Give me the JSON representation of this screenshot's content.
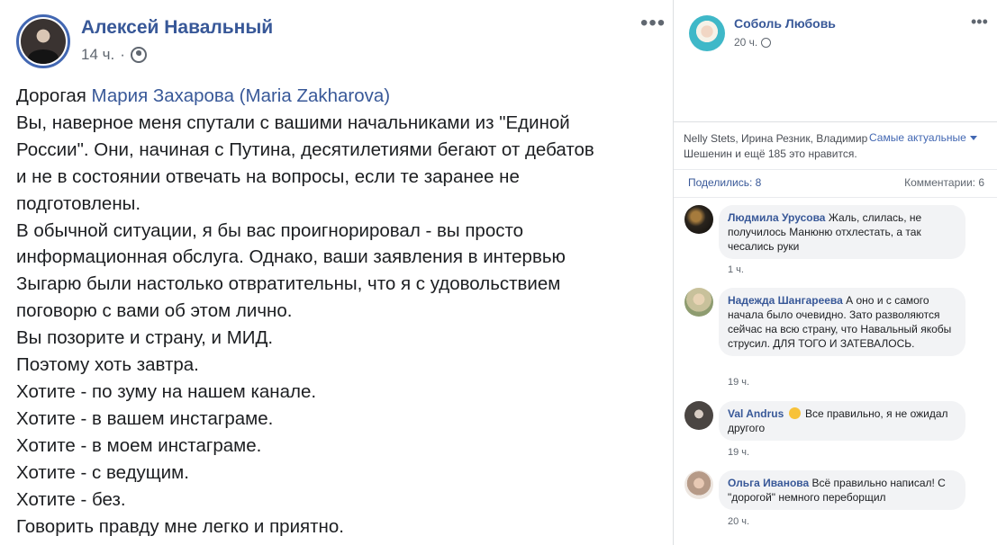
{
  "post": {
    "author": "Алексей Навальный",
    "time": "14 ч.",
    "menu": "•••",
    "lines": [
      {
        "pre": "Дорогая ",
        "mention": "Мария Захарова (Maria Zakharova)"
      },
      {
        "text": "Вы, наверное меня спутали с вашими начальниками из \"Единой"
      },
      {
        "text": "России\". Они, начиная с Путина, десятилетиями бегают от дебатов"
      },
      {
        "text": "и не в состоянии отвечать на вопросы, если те заранее не"
      },
      {
        "text": "подготовлены."
      },
      {
        "text": "В обычной ситуации, я бы вас проигнорировал - вы просто"
      },
      {
        "text": "информационная обслуга. Однако, ваши заявления в интервью"
      },
      {
        "text": "Зыгарю были настолько отвратительны, что я с удовольствием"
      },
      {
        "text": "поговорю с вами об этом лично."
      },
      {
        "text": "Вы позорите и страну, и МИД."
      },
      {
        "text": "Поэтому хоть завтра."
      },
      {
        "text": "Хотите - по зуму на нашем канале."
      },
      {
        "text": "Хотите - в вашем инстаграме."
      },
      {
        "text": "Хотите - в моем инстаграме."
      },
      {
        "text": "Хотите - с ведущим."
      },
      {
        "text": "Хотите - без."
      },
      {
        "text": "Говорить правду мне легко и приятно."
      }
    ]
  },
  "side": {
    "author": "Соболь Любовь",
    "time": "20 ч.",
    "menu": "•••",
    "likes": "Nelly Stets, Ирина Резник, Владимир Шешенин и ещё 185 это нравится.",
    "sort": "Самые актуальные",
    "shares": "Поделились: 8",
    "comments_count": "Комментарии: 6",
    "comments": [
      {
        "name": "Людмила Урусова",
        "text": "Жаль, слилась, не получилось Манюню отхлестать, а так чесались руки",
        "time": "1 ч."
      },
      {
        "name": "Надежда Шангареева",
        "text": "А оно и с самого начала было очевидно. Зато разволяются сейчас на всю страну, что Навальный якобы струсил. ДЛЯ ТОГО И ЗАТЕВАЛОСЬ.",
        "time": "19 ч."
      },
      {
        "name": "Val Andrus",
        "text": "Все правильно, я не ожидал другого",
        "time": "19 ч."
      },
      {
        "name": "Ольга Иванова",
        "text": "Всё правильно написал! С \"дорогой\" немного переборщил",
        "time": "20 ч."
      }
    ]
  }
}
